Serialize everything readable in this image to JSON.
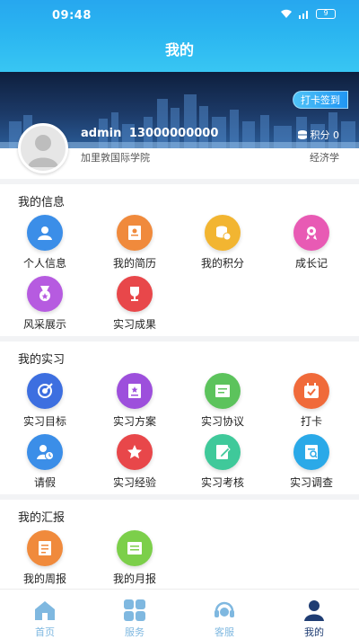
{
  "status": {
    "time": "09:48",
    "battery": "9"
  },
  "header": {
    "title": "我的"
  },
  "profile": {
    "checkin_label": "打卡签到",
    "username": "admin",
    "phone": "13000000000",
    "points_label": "积分 0",
    "school": "加里敦国际学院",
    "major": "经济学"
  },
  "sections": [
    {
      "title": "我的信息",
      "items": [
        {
          "label": "个人信息",
          "icon": "person-icon",
          "color": "#3b8ee8"
        },
        {
          "label": "我的简历",
          "icon": "resume-icon",
          "color": "#f08a3c"
        },
        {
          "label": "我的积分",
          "icon": "coins-icon",
          "color": "#f2b531"
        },
        {
          "label": "成长记",
          "icon": "growth-icon",
          "color": "#e85ab4"
        },
        {
          "label": "风采展示",
          "icon": "medal-icon",
          "color": "#b65be0"
        },
        {
          "label": "实习成果",
          "icon": "trophy-icon",
          "color": "#e8474a"
        }
      ]
    },
    {
      "title": "我的实习",
      "items": [
        {
          "label": "实习目标",
          "icon": "target-icon",
          "color": "#3d6fe0"
        },
        {
          "label": "实习方案",
          "icon": "plan-icon",
          "color": "#9d4fdc"
        },
        {
          "label": "实习协议",
          "icon": "agreement-icon",
          "color": "#5cc35c"
        },
        {
          "label": "打卡",
          "icon": "clock-in-icon",
          "color": "#f06a3a"
        },
        {
          "label": "请假",
          "icon": "leave-icon",
          "color": "#3b8ee8"
        },
        {
          "label": "实习经验",
          "icon": "star-icon",
          "color": "#e8474a"
        },
        {
          "label": "实习考核",
          "icon": "assessment-icon",
          "color": "#3fc99a"
        },
        {
          "label": "实习调查",
          "icon": "survey-icon",
          "color": "#2aa9e8"
        }
      ]
    },
    {
      "title": "我的汇报",
      "items": [
        {
          "label": "我的周报",
          "icon": "weekly-report-icon",
          "color": "#f08a3c"
        },
        {
          "label": "我的月报",
          "icon": "monthly-report-icon",
          "color": "#7ccf4a"
        }
      ]
    }
  ],
  "tabbar": [
    {
      "label": "首页",
      "icon": "home-icon",
      "active": false
    },
    {
      "label": "服务",
      "icon": "grid-icon",
      "active": false
    },
    {
      "label": "客服",
      "icon": "headset-icon",
      "active": false
    },
    {
      "label": "我的",
      "icon": "user-icon",
      "active": true
    }
  ]
}
